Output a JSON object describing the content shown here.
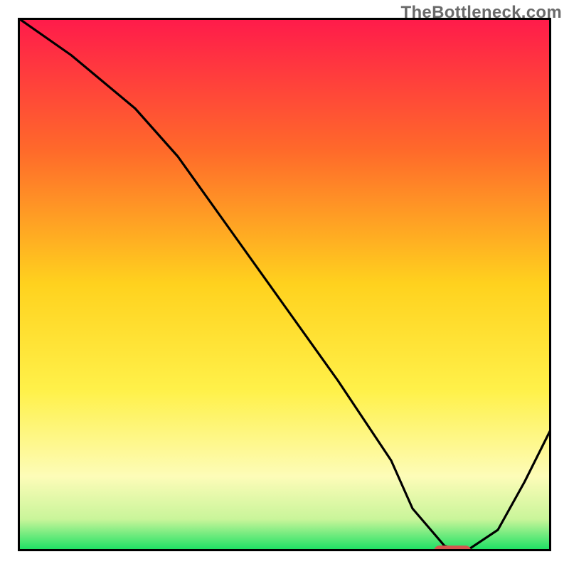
{
  "watermark": "TheBottleneck.com",
  "chart_data": {
    "type": "line",
    "title": "",
    "xlabel": "",
    "ylabel": "",
    "xlim": [
      0,
      100
    ],
    "ylim": [
      0,
      100
    ],
    "x": [
      0,
      10,
      22,
      30,
      40,
      50,
      60,
      70,
      74,
      80,
      84,
      90,
      95,
      100
    ],
    "values": [
      100,
      93,
      83,
      74,
      60,
      46,
      32,
      17,
      8,
      1,
      0,
      4,
      13,
      23
    ],
    "optimum_marker": {
      "x_start": 78,
      "x_end": 85,
      "y": 0
    },
    "background": {
      "type": "vertical-gradient",
      "stops": [
        {
          "pos": 0.0,
          "color": "#ff1a4b"
        },
        {
          "pos": 0.25,
          "color": "#ff6a2a"
        },
        {
          "pos": 0.5,
          "color": "#ffd21e"
        },
        {
          "pos": 0.7,
          "color": "#fff14a"
        },
        {
          "pos": 0.86,
          "color": "#fdfcb8"
        },
        {
          "pos": 0.94,
          "color": "#c9f59a"
        },
        {
          "pos": 1.0,
          "color": "#14e061"
        }
      ]
    },
    "marker_color": "#d4574f",
    "line_color": "#000000",
    "frame_color": "#000000"
  }
}
